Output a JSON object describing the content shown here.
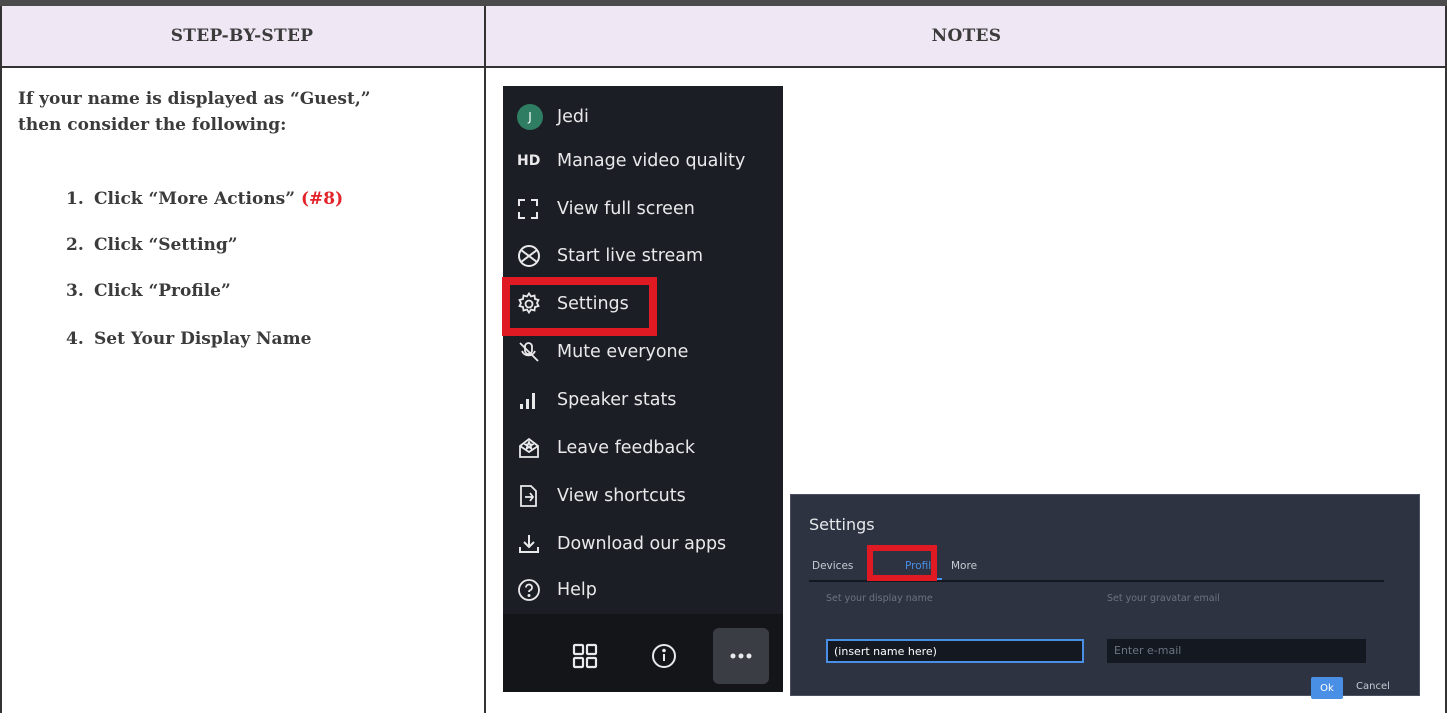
{
  "table": {
    "headers": {
      "left": "STEP-BY-STEP",
      "right": "NOTES"
    }
  },
  "steps": {
    "intro_line1": "If your name is displayed as “Guest,”",
    "intro_line2": "then consider the following:",
    "items": [
      {
        "num": "1.",
        "text": "Click “More Actions” ",
        "highlight": "(#8)"
      },
      {
        "num": "2.",
        "text": "Click “Setting”"
      },
      {
        "num": "3.",
        "text": "Click “Profile”"
      },
      {
        "num": "4.",
        "text": "Set Your Display Name"
      }
    ],
    "highlight_color": "#e2242a"
  },
  "menu": {
    "avatar_letter": "J",
    "items": [
      {
        "label": "Jedi",
        "icon": "avatar-icon"
      },
      {
        "label": "Manage video quality",
        "icon": "hd-icon",
        "icon_text": "HD"
      },
      {
        "label": "View full screen",
        "icon": "fullscreen-icon"
      },
      {
        "label": "Start live stream",
        "icon": "globe-icon"
      },
      {
        "label": "Settings",
        "icon": "gear-icon"
      },
      {
        "label": "Mute everyone",
        "icon": "mute-icon"
      },
      {
        "label": "Speaker stats",
        "icon": "bar-chart-icon"
      },
      {
        "label": "Leave feedback",
        "icon": "feedback-icon"
      },
      {
        "label": "View shortcuts",
        "icon": "shortcuts-icon"
      },
      {
        "label": "Download our apps",
        "icon": "download-icon"
      },
      {
        "label": "Help",
        "icon": "help-icon"
      }
    ],
    "footer_icons": [
      "grid-view-icon",
      "info-icon",
      "more-actions-icon"
    ]
  },
  "settings_dialog": {
    "title": "Settings",
    "tabs": [
      "Devices",
      "Profile",
      "More"
    ],
    "active_tab": "Profile",
    "display_name_label": "Set your display name",
    "display_name_value": "(insert name here)",
    "email_label": "Set your gravatar email",
    "email_placeholder": "Enter e-mail",
    "ok_label": "Ok",
    "cancel_label": "Cancel"
  },
  "colors": {
    "header_bg": "#efe7f3",
    "callout_red": "#e01a22",
    "menu_bg": "#1b1e24",
    "dialog_bg": "#2d3340",
    "accent_blue": "#4a8fe6"
  }
}
